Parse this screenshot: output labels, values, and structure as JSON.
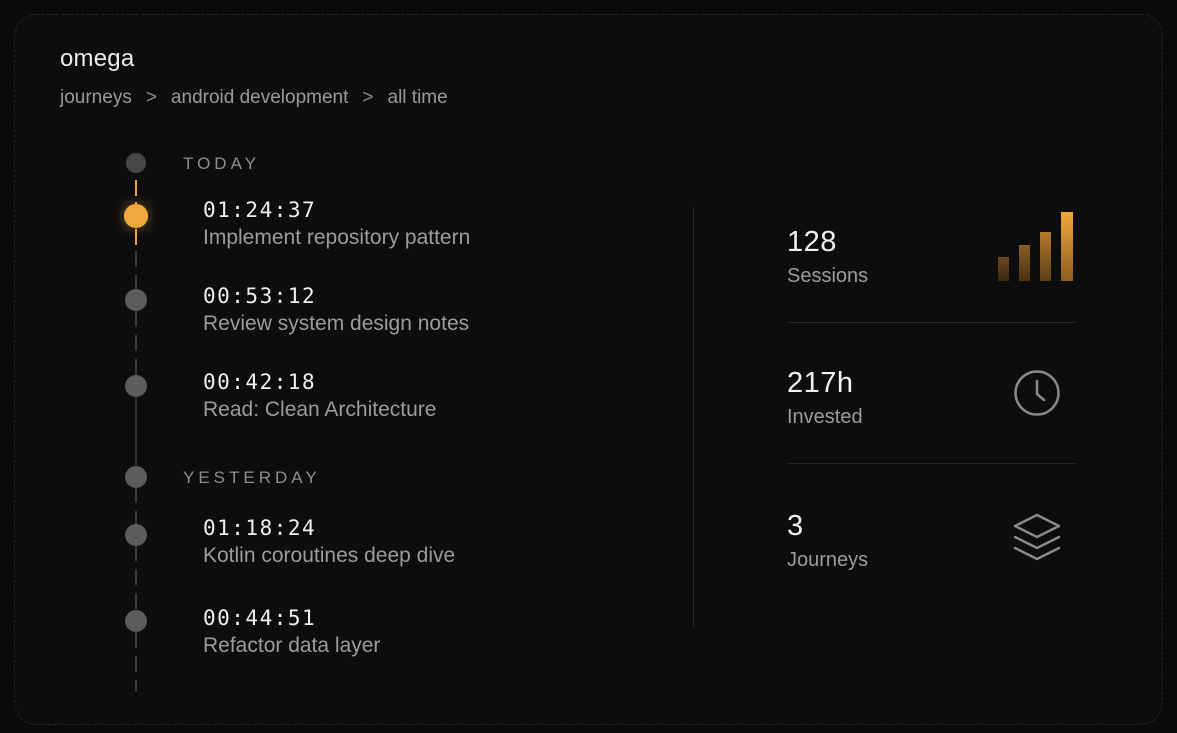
{
  "header": {
    "app_title": "omega",
    "breadcrumb": [
      "journeys",
      "android development",
      "all time"
    ],
    "separator": ">"
  },
  "timeline": {
    "groups": [
      {
        "label": "TODAY",
        "entries": [
          {
            "time": "01:24:37",
            "task": "Implement repository pattern",
            "active": true
          },
          {
            "time": "00:53:12",
            "task": "Review system design notes",
            "active": false
          },
          {
            "time": "00:42:18",
            "task": "Read: Clean Architecture",
            "active": false
          }
        ]
      },
      {
        "label": "YESTERDAY",
        "entries": [
          {
            "time": "01:18:24",
            "task": "Kotlin coroutines deep dive",
            "active": false
          },
          {
            "time": "00:44:51",
            "task": "Refactor data layer",
            "active": false
          }
        ]
      }
    ]
  },
  "stats": [
    {
      "value": "128",
      "label": "Sessions",
      "icon": "bar-chart-icon"
    },
    {
      "value": "217h",
      "label": "Invested",
      "icon": "clock-icon"
    },
    {
      "value": "3",
      "label": "Journeys",
      "icon": "layers-icon"
    }
  ],
  "colors": {
    "accent": "#f2a83c",
    "background": "#0d0d0d",
    "text_primary": "#efefef",
    "text_secondary": "#9c9c9c"
  }
}
